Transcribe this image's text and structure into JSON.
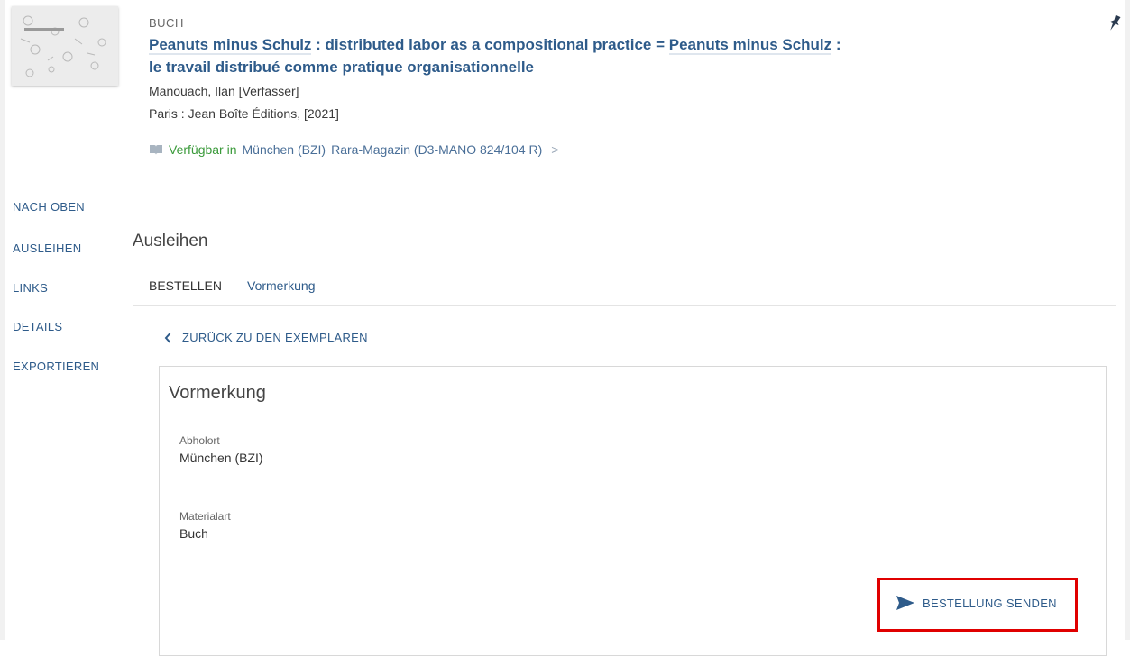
{
  "record": {
    "type": "BUCH",
    "title_part1": "Peanuts minus Schulz",
    "title_part2": " : distributed labor as a compositional practice = ",
    "title_part3": "Peanuts minus Schulz",
    "title_part4": " :",
    "title_line2": "le travail distribué comme pratique organisationnelle",
    "author": "Manouach, Ilan [Verfasser]",
    "publication": "Paris : Jean Boîte Éditions, [2021]",
    "availability": {
      "status": "Verfügbar in",
      "library": "München (BZI)",
      "location": "Rara-Magazin (D3-MANO 824/104 R)",
      "chevron": ">"
    }
  },
  "nav": {
    "items": [
      "NACH OBEN",
      "AUSLEIHEN",
      "LINKS",
      "DETAILS",
      "EXPORTIEREN"
    ]
  },
  "section": {
    "title": "Ausleihen",
    "tabs": [
      "BESTELLEN",
      "Vormerkung"
    ],
    "back_label": "ZURÜCK ZU DEN EXEMPLAREN"
  },
  "form": {
    "title": "Vormerkung",
    "fields": [
      {
        "label": "Abholort",
        "value": "München (BZI)"
      },
      {
        "label": "Materialart",
        "value": "Buch"
      }
    ],
    "submit_label": "BESTELLUNG SENDEN"
  },
  "colors": {
    "link": "#2e5b8a",
    "available": "#3a9a3a",
    "highlight": "#e00000"
  },
  "icons": [
    "pin-icon",
    "book-icon",
    "chevron-left-icon",
    "send-icon"
  ]
}
